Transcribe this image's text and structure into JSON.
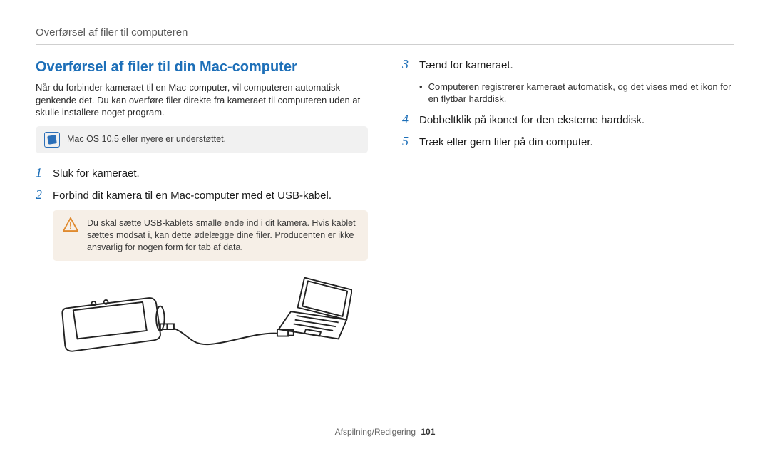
{
  "breadcrumb": "Overførsel af filer til computeren",
  "section_title": "Overførsel af filer til din Mac-computer",
  "intro": "Når du forbinder kameraet til en Mac-computer, vil computeren automatisk genkende det. Du kan overføre filer direkte fra kameraet til computeren uden at skulle installere noget program.",
  "note_text": "Mac OS 10.5 eller nyere er understøttet.",
  "warn_text": "Du skal sætte USB-kablets smalle ende ind i dit kamera. Hvis kablet sættes modsat i, kan dette ødelægge dine filer. Producenten er ikke ansvarlig for nogen form for tab af data.",
  "left_steps": [
    {
      "num": "1",
      "text": "Sluk for kameraet."
    },
    {
      "num": "2",
      "text": "Forbind dit kamera til en Mac-computer med et USB-kabel."
    }
  ],
  "right_steps": {
    "s3": {
      "num": "3",
      "text": "Tænd for kameraet."
    },
    "s3_bullet": "Computeren registrerer kameraet automatisk, og det vises med et ikon for en flytbar harddisk.",
    "s4": {
      "num": "4",
      "text": "Dobbeltklik på ikonet for den eksterne harddisk."
    },
    "s5": {
      "num": "5",
      "text": "Træk eller gem filer på din computer."
    }
  },
  "footer_label": "Afspilning/Redigering",
  "footer_page": "101"
}
